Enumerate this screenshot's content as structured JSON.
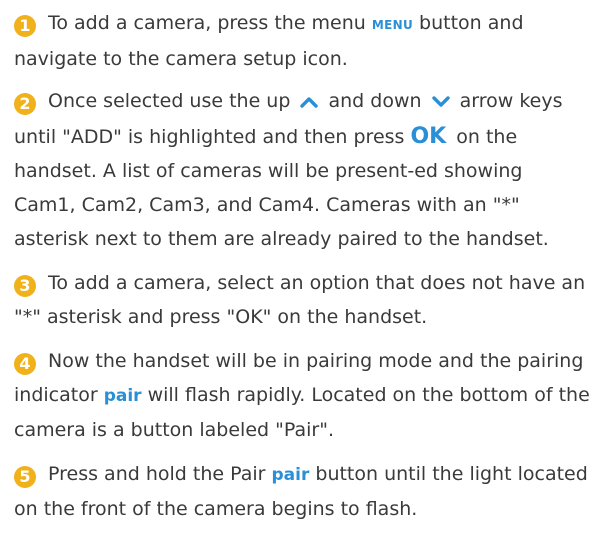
{
  "accent_color": "#2a8fd6",
  "badge_color": "#f0b11a",
  "steps": [
    {
      "number": "1",
      "p1": "To add a camera, press the menu ",
      "menu_label": "MENU",
      "p2": " button and navigate to the camera setup icon."
    },
    {
      "number": "2",
      "p1": "Once selected use the up ",
      "p2": " and down ",
      "p3": " arrow keys until \"ADD\" is highlighted and then press ",
      "ok_label": "OK",
      "p4": " on the handset. A list of cameras will be present-ed showing Cam1, Cam2, Cam3, and Cam4. Cameras with an \"*\" asterisk next to them are already paired to the handset."
    },
    {
      "number": "3",
      "text": "To add a camera, select an option that does not have an \"*\" asterisk and press \"OK\" on the handset."
    },
    {
      "number": "4",
      "p1": "Now the handset will be in pairing mode and the pairing indicator ",
      "pair_label": "pair",
      "p2": " will flash rapidly. Located on the bottom of the camera is a button labeled \"Pair\"."
    },
    {
      "number": "5",
      "p1": "Press and hold the Pair ",
      "pair_label": "pair",
      "p2": " button until the light located on the front of the camera begins to flash."
    }
  ],
  "icons": {
    "up": "chevron-up-icon",
    "down": "chevron-down-icon"
  }
}
